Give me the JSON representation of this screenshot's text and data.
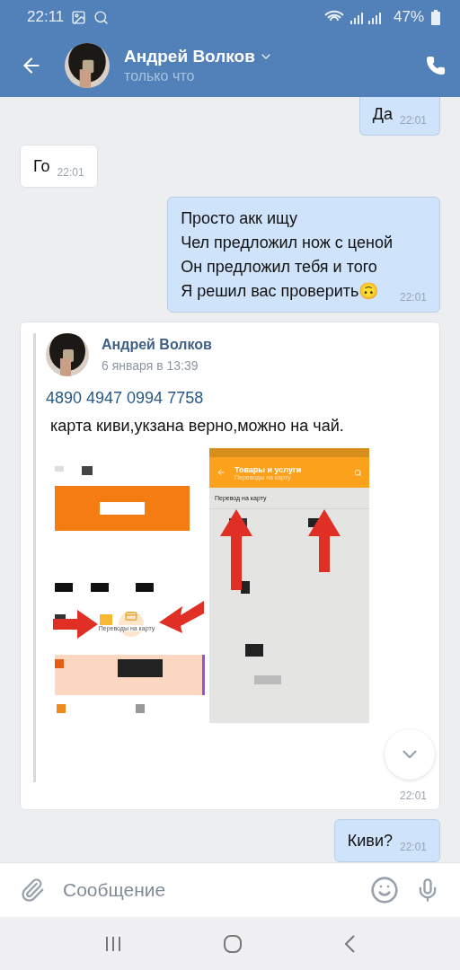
{
  "status_bar": {
    "time": "22:11",
    "battery": "47%"
  },
  "header": {
    "name": "Андрей Волков",
    "status": "только что"
  },
  "messages": [
    {
      "kind": "text",
      "outgoing": true,
      "lines": [
        "Да"
      ],
      "time": "22:01"
    },
    {
      "kind": "text",
      "outgoing": false,
      "lines": [
        "Го"
      ],
      "time": "22:01"
    },
    {
      "kind": "text",
      "outgoing": true,
      "lines": [
        "Просто акк ищу",
        "Чел предложил нож с ценой",
        "Он предложил тебя и того",
        "Я решил вас проверить🙃"
      ],
      "time": "22:01"
    },
    {
      "kind": "forward",
      "outgoing": false,
      "author": "Андрей Волков",
      "date": "6 января в 13:39",
      "link": "4890 4947 0994 7758",
      "text": " карта киви,укзана верно,можно на чай.",
      "attachment": {
        "tile_label": "Переводы на карту",
        "app_title": "Товары и услуги",
        "app_subtitle": "Переводы на карту",
        "row_label": "Перевод на карту"
      },
      "time": "22:01"
    },
    {
      "kind": "text",
      "outgoing": true,
      "lines": [
        "Киви?"
      ],
      "time": "22:01"
    }
  ],
  "composer": {
    "placeholder": "Сообщение"
  }
}
